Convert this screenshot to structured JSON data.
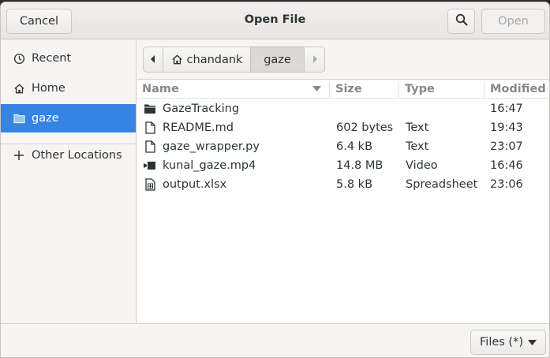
{
  "dialog": {
    "title": "Open File",
    "cancel_label": "Cancel",
    "open_label": "Open"
  },
  "sidebar": {
    "items": [
      {
        "label": "Recent",
        "icon": "clock-icon"
      },
      {
        "label": "Home",
        "icon": "home-icon"
      },
      {
        "label": "gaze",
        "icon": "folder-icon",
        "active": true
      },
      {
        "label": "Other Locations",
        "icon": "plus-icon"
      }
    ]
  },
  "pathbar": {
    "home_label": "chandank",
    "current_label": "gaze"
  },
  "columns": {
    "name": "Name",
    "size": "Size",
    "type": "Type",
    "modified": "Modified"
  },
  "files": [
    {
      "name": "GazeTracking",
      "size": "",
      "type": "",
      "modified": "16:47",
      "icon": "folder-icon"
    },
    {
      "name": "README.md",
      "size": "602 bytes",
      "type": "Text",
      "modified": "19:43",
      "icon": "text-file-icon"
    },
    {
      "name": "gaze_wrapper.py",
      "size": "6.4 kB",
      "type": "Text",
      "modified": "23:07",
      "icon": "text-file-icon"
    },
    {
      "name": "kunal_gaze.mp4",
      "size": "14.8 MB",
      "type": "Video",
      "modified": "16:46",
      "icon": "video-file-icon"
    },
    {
      "name": "output.xlsx",
      "size": "5.8 kB",
      "type": "Spreadsheet",
      "modified": "23:06",
      "icon": "spreadsheet-file-icon"
    }
  ],
  "filter": {
    "label": "Files (*)"
  },
  "colors": {
    "accent": "#3584e4",
    "window_bg": "#f6f5f4"
  }
}
